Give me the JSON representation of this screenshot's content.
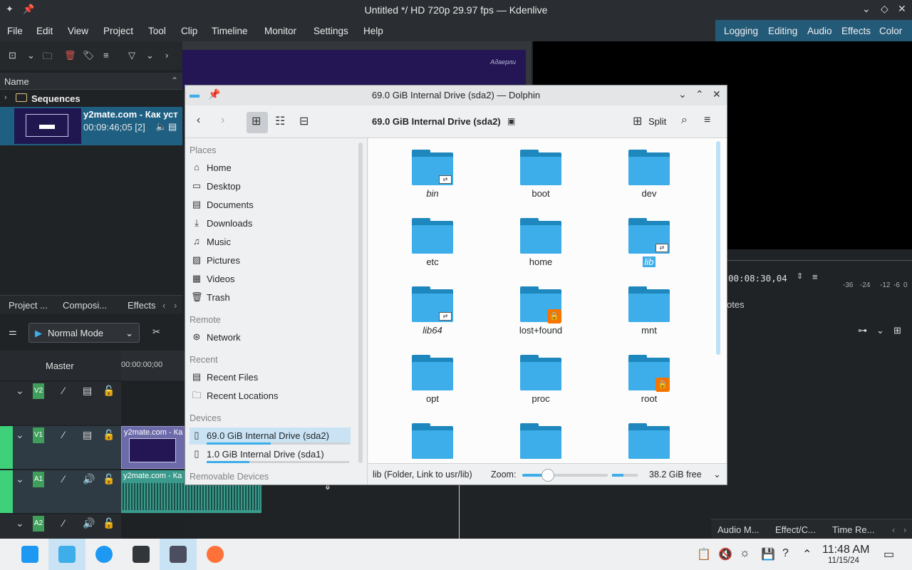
{
  "window": {
    "title": "Untitled */ HD 720p 29.97 fps — Kdenlive"
  },
  "menu": [
    "File",
    "Edit",
    "View",
    "Project",
    "Tool",
    "Clip",
    "Timeline",
    "Monitor",
    "Settings",
    "Help"
  ],
  "layouts": [
    "Logging",
    "Editing",
    "Audio",
    "Effects",
    "Color"
  ],
  "bin": {
    "header": "Name",
    "folder": "Sequences",
    "clip_name": "y2mate.com - Как уст",
    "clip_duration": "00:09:46;05 [2]"
  },
  "monitor_label": "Адаерли",
  "left_tabs": [
    "Project ...",
    "Composi...",
    "Effects"
  ],
  "mode": "Normal Mode",
  "timeline": {
    "master": "Master",
    "timecode": "00:00:00;00",
    "tracks": [
      {
        "tag": "V2"
      },
      {
        "tag": "V1",
        "clip": "y2mate.com - Ка"
      },
      {
        "tag": "A1",
        "clip": "y2mate.com - Ка"
      },
      {
        "tag": "A2"
      }
    ]
  },
  "right_panel": {
    "timecode": "00:08:30,04",
    "db": [
      "-36",
      "-24",
      "-12",
      "-6",
      "0"
    ],
    "notes": "otes",
    "bottom_tabs": [
      "Audio M...",
      "Effect/C...",
      "Time Re..."
    ]
  },
  "dolphin": {
    "title": "69.0 GiB Internal Drive (sda2) — Dolphin",
    "path": "69.0 GiB Internal Drive (sda2)",
    "split_label": "Split",
    "places": {
      "header": "Places",
      "items": [
        {
          "label": "Home",
          "icon": "home-icon"
        },
        {
          "label": "Desktop",
          "icon": "desktop-icon"
        },
        {
          "label": "Documents",
          "icon": "documents-icon"
        },
        {
          "label": "Downloads",
          "icon": "downloads-icon"
        },
        {
          "label": "Music",
          "icon": "music-icon"
        },
        {
          "label": "Pictures",
          "icon": "pictures-icon"
        },
        {
          "label": "Videos",
          "icon": "videos-icon"
        },
        {
          "label": "Trash",
          "icon": "trash-icon"
        }
      ],
      "remote_header": "Remote",
      "remote_items": [
        "Network"
      ],
      "recent_header": "Recent",
      "recent_items": [
        "Recent Files",
        "Recent Locations"
      ],
      "devices_header": "Devices",
      "devices": [
        {
          "label": "69.0 GiB Internal Drive (sda2)",
          "usage": 0.45
        },
        {
          "label": "1.0 GiB Internal Drive (sda1)",
          "usage": 0.3
        }
      ],
      "removable_header": "Removable Devices"
    },
    "files": [
      {
        "name": "bin",
        "link": true
      },
      {
        "name": "boot"
      },
      {
        "name": "dev"
      },
      {
        "name": "etc"
      },
      {
        "name": "home"
      },
      {
        "name": "lib",
        "link": true,
        "selected": true
      },
      {
        "name": "lib64",
        "link": true
      },
      {
        "name": "lost+found",
        "locked": true
      },
      {
        "name": "mnt"
      },
      {
        "name": "opt"
      },
      {
        "name": "proc"
      },
      {
        "name": "root",
        "locked": true
      },
      {
        "name": ""
      },
      {
        "name": ""
      },
      {
        "name": ""
      }
    ],
    "status": "lib (Folder, Link to usr/lib)",
    "zoom_label": "Zoom:",
    "zoom_level": 0.3,
    "disk_usage": 0.45,
    "free_space": "38.2 GiB free"
  },
  "taskbar": {
    "time": "11:48 AM",
    "date": "11/15/24"
  }
}
